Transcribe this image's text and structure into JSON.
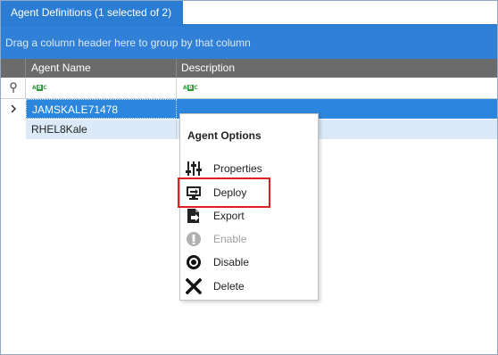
{
  "tab": {
    "label": "Agent Definitions (1 selected of 2)"
  },
  "group_panel": {
    "hint": "Drag a column header here to group by that column"
  },
  "columns": [
    "Agent Name",
    "Description"
  ],
  "filter_icon_text": "ABC",
  "rows": [
    {
      "name": "JAMSKALE71478",
      "description": "",
      "selected": true
    },
    {
      "name": "RHEL8Kale",
      "description": "",
      "selected": false
    }
  ],
  "context_menu": {
    "title": "Agent Options",
    "items": [
      {
        "label": "Properties",
        "icon": "properties-icon",
        "enabled": true
      },
      {
        "label": "Deploy",
        "icon": "deploy-icon",
        "enabled": true,
        "highlighted": true
      },
      {
        "label": "Export",
        "icon": "export-icon",
        "enabled": true
      },
      {
        "label": "Enable",
        "icon": "info-icon",
        "enabled": false
      },
      {
        "label": "Disable",
        "icon": "disable-icon",
        "enabled": true
      },
      {
        "label": "Delete",
        "icon": "delete-x-icon",
        "enabled": true
      }
    ]
  },
  "colors": {
    "tab_bg": "#2b7cd3",
    "group_panel_bg": "#2f80d6",
    "header_bg": "#6b6b6b",
    "selected_row_bg": "#2d86dd",
    "alt_row_bg": "#dbe9f8",
    "highlight_border": "#d8201f"
  }
}
